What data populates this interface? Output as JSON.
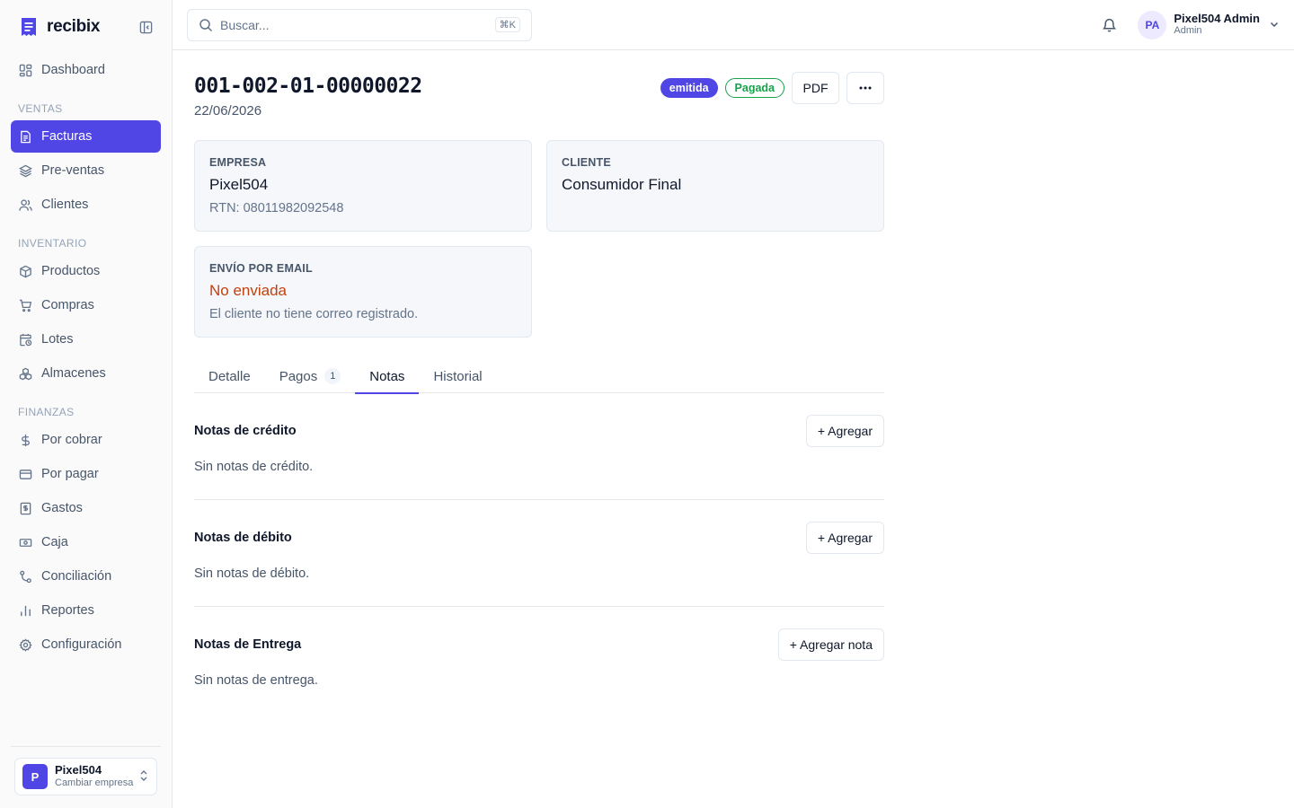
{
  "brand": {
    "name": "recibix"
  },
  "sidebar": {
    "items": [
      {
        "label": "Dashboard",
        "icon": "dashboard-icon"
      },
      {
        "section": "VENTAS"
      },
      {
        "label": "Facturas",
        "icon": "invoice-icon",
        "active": true
      },
      {
        "label": "Pre-ventas",
        "icon": "layers-icon"
      },
      {
        "label": "Clientes",
        "icon": "users-icon"
      },
      {
        "section": "INVENTARIO"
      },
      {
        "label": "Productos",
        "icon": "package-icon"
      },
      {
        "label": "Compras",
        "icon": "cart-icon"
      },
      {
        "label": "Lotes",
        "icon": "calendar-clock-icon"
      },
      {
        "label": "Almacenes",
        "icon": "boxes-icon"
      },
      {
        "section": "FINANZAS"
      },
      {
        "label": "Por cobrar",
        "icon": "dollar-icon"
      },
      {
        "label": "Por pagar",
        "icon": "credit-card-icon"
      },
      {
        "label": "Gastos",
        "icon": "receipt-icon"
      },
      {
        "label": "Caja",
        "icon": "banknote-icon"
      },
      {
        "label": "Conciliación",
        "icon": "git-compare-icon"
      },
      {
        "label": "Reportes",
        "icon": "bar-chart-icon"
      },
      {
        "label": "Configuración",
        "icon": "settings-icon"
      }
    ],
    "company": {
      "initial": "P",
      "name": "Pixel504",
      "sub": "Cambiar empresa"
    }
  },
  "topbar": {
    "search_placeholder": "Buscar...",
    "shortcut": "⌘K",
    "user": {
      "initials": "PA",
      "name": "Pixel504 Admin",
      "role": "Admin"
    }
  },
  "invoice": {
    "number": "001-002-01-00000022",
    "date": "22/06/2026",
    "status_badges": [
      "emitida",
      "Pagada"
    ],
    "pdf_label": "PDF"
  },
  "cards": {
    "empresa": {
      "label": "EMPRESA",
      "title": "Pixel504",
      "sub": "RTN: 08011982092548"
    },
    "cliente": {
      "label": "CLIENTE",
      "title": "Consumidor Final"
    },
    "email": {
      "label": "ENVÍO POR EMAIL",
      "title": "No enviada",
      "sub": "El cliente no tiene correo registrado."
    }
  },
  "tabs": [
    {
      "label": "Detalle"
    },
    {
      "label": "Pagos",
      "count": "1"
    },
    {
      "label": "Notas",
      "active": true
    },
    {
      "label": "Historial"
    }
  ],
  "sections": [
    {
      "title": "Notas de crédito",
      "button": "+ Agregar",
      "empty": "Sin notas de crédito."
    },
    {
      "title": "Notas de débito",
      "button": "+ Agregar",
      "empty": "Sin notas de débito."
    },
    {
      "title": "Notas de Entrega",
      "button": "+ Agregar nota",
      "empty": "Sin notas de entrega."
    }
  ],
  "colors": {
    "accent": "#4f46e5",
    "success": "#16a34a",
    "warning": "#c2410c"
  }
}
